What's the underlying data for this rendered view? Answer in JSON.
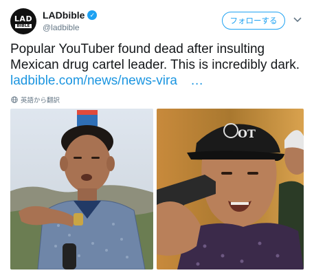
{
  "account": {
    "display_name": "LADbible",
    "handle": "@ladbible",
    "avatar_line1": "LAD",
    "avatar_line2": "BIBLE"
  },
  "follow_button_label": "フォローする",
  "tweet": {
    "text": "Popular YouTuber found dead after insulting Mexican drug cartel leader. This is incredibly dark.",
    "link": "ladbible.com/news/news-vira",
    "ellipsis": "…"
  },
  "translate_label": "英語から翻訳",
  "photos": [
    {
      "cap_text": ""
    },
    {
      "cap_text": "OT"
    }
  ],
  "colors": {
    "accent": "#1da1f2",
    "link": "#1b95e0",
    "muted": "#657786"
  }
}
